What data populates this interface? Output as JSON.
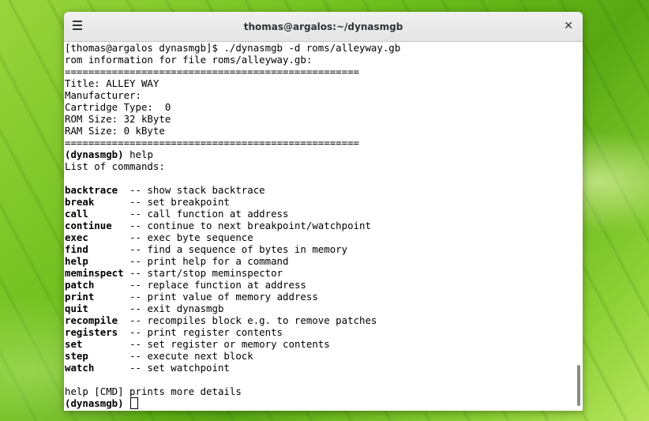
{
  "window": {
    "title": "thomas@argalos:~/dynasmgb",
    "close_label": "✕"
  },
  "terminal": {
    "lines": [
      "[thomas@argalos dynasmgb]$ ./dynasmgb -d roms/alleyway.gb",
      "rom information for file roms/alleyway.gb:",
      "==================================================",
      "Title: ALLEY WAY",
      "Manufacturer:",
      "Cartridge Type:  0",
      "ROM Size: 32 kByte",
      "RAM Size: 0 kByte",
      "==================================================",
      "help",
      "List of commands:",
      ""
    ],
    "prompt": "(dynasmgb)",
    "commands": [
      {
        "name": "backtrace",
        "desc": "-- show stack backtrace"
      },
      {
        "name": "break",
        "desc": "-- set breakpoint"
      },
      {
        "name": "call",
        "desc": "-- call function at address"
      },
      {
        "name": "continue",
        "desc": "-- continue to next breakpoint/watchpoint"
      },
      {
        "name": "exec",
        "desc": "-- exec byte sequence"
      },
      {
        "name": "find",
        "desc": "-- find a sequence of bytes in memory"
      },
      {
        "name": "help",
        "desc": "-- print help for a command"
      },
      {
        "name": "meminspect",
        "desc": "-- start/stop meminspector"
      },
      {
        "name": "patch",
        "desc": "-- replace function at address"
      },
      {
        "name": "print",
        "desc": "-- print value of memory address"
      },
      {
        "name": "quit",
        "desc": "-- exit dynasmgb"
      },
      {
        "name": "recompile",
        "desc": "-- recompiles block e.g. to remove patches"
      },
      {
        "name": "registers",
        "desc": "-- print register contents"
      },
      {
        "name": "set",
        "desc": "-- set register or memory contents"
      },
      {
        "name": "step",
        "desc": "-- execute next block"
      },
      {
        "name": "watch",
        "desc": "-- set watchpoint"
      }
    ],
    "footer_lines": [
      "",
      "help [CMD] prints more details"
    ],
    "current_input": ""
  }
}
